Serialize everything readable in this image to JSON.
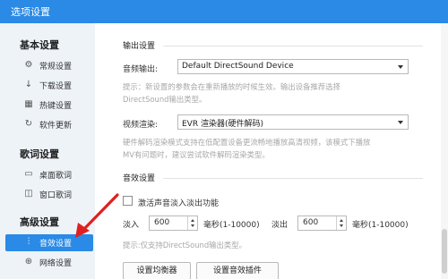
{
  "window": {
    "title": "选项设置"
  },
  "sidebar": {
    "groups": [
      {
        "title": "基本设置",
        "items": [
          {
            "label": "常规设置",
            "icon": "gear-icon"
          },
          {
            "label": "下载设置",
            "icon": "download-icon"
          },
          {
            "label": "热键设置",
            "icon": "keyboard-icon"
          },
          {
            "label": "软件更新",
            "icon": "refresh-icon"
          }
        ]
      },
      {
        "title": "歌词设置",
        "items": [
          {
            "label": "桌面歌词",
            "icon": "desktop-icon"
          },
          {
            "label": "窗口歌词",
            "icon": "window-icon"
          }
        ]
      },
      {
        "title": "高级设置",
        "items": [
          {
            "label": "音效设置",
            "icon": "equalizer-icon",
            "active": true
          },
          {
            "label": "网络设置",
            "icon": "globe-icon"
          }
        ]
      }
    ]
  },
  "output": {
    "section_title": "输出设置",
    "audio_output_label": "音频输出:",
    "audio_output_value": "Default DirectSound Device",
    "hint_1": "提示：新设置的参数会在重新播放的时候生效。输出设备推荐选择",
    "hint_2": "DirectSound输出类型。",
    "video_render_label": "视频渲染:",
    "video_render_value": "EVR 渲染器(硬件解码)",
    "hint_3": "硬件解码渲染模式支持在低配置设备更流畅地播放高清视频，该模式下播放",
    "hint_4": "MV有问题时，建议尝试软件解码渲染类型。"
  },
  "sound": {
    "section_title": "音效设置",
    "fade_checkbox_label": "激活声音淡入淡出功能",
    "fade_checked": false,
    "fade_in_label": "淡入",
    "fade_in_value": "600",
    "fade_in_unit": "毫秒(1-10000)",
    "fade_out_label": "淡出",
    "fade_out_value": "600",
    "fade_out_unit": "毫秒(1-10000)",
    "hint": "提示:仅支持DirectSound输出类型。",
    "eq_button": "设置均衡器",
    "plugin_button": "设置音效插件"
  },
  "colors": {
    "accent": "#2a8ae6",
    "sidebar_bg": "#eef3f8",
    "arrow": "#e02020"
  }
}
